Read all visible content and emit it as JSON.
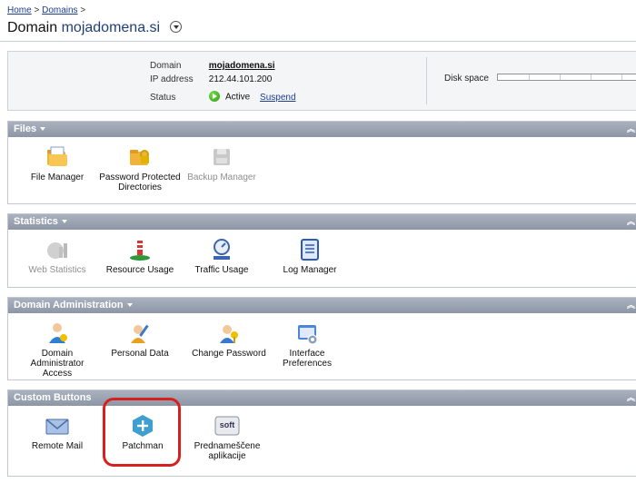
{
  "breadcrumb": {
    "home": "Home",
    "sep": ">",
    "domains": "Domains",
    "sep2": ">"
  },
  "title": {
    "prefix": "Domain",
    "domain": "mojadomena.si"
  },
  "info": {
    "domain_label": "Domain",
    "domain_value": "mojadomena.si",
    "ip_label": "IP address",
    "ip_value": "212.44.101.200",
    "status_label": "Status",
    "status_value": "Active",
    "suspend_link": "Suspend",
    "disk_label": "Disk space"
  },
  "sections": [
    {
      "title": "Files",
      "items": [
        {
          "label": "File Manager",
          "icon": "file-manager-icon"
        },
        {
          "label": "Password Protected Directories",
          "icon": "password-folder-icon"
        },
        {
          "label": "Backup Manager",
          "icon": "backup-manager-icon",
          "disabled": true
        }
      ]
    },
    {
      "title": "Statistics",
      "items": [
        {
          "label": "Web Statistics",
          "icon": "web-statistics-icon",
          "disabled": true
        },
        {
          "label": "Resource Usage",
          "icon": "resource-usage-icon"
        },
        {
          "label": "Traffic Usage",
          "icon": "traffic-usage-icon"
        },
        {
          "label": "Log Manager",
          "icon": "log-manager-icon"
        }
      ]
    },
    {
      "title": "Domain Administration",
      "items": [
        {
          "label": "Domain Administrator Access",
          "icon": "admin-access-icon"
        },
        {
          "label": "Personal Data",
          "icon": "personal-data-icon"
        },
        {
          "label": "Change Password",
          "icon": "change-password-icon"
        },
        {
          "label": "Interface Preferences",
          "icon": "interface-preferences-icon"
        }
      ]
    },
    {
      "title": "Custom Buttons",
      "items": [
        {
          "label": "Remote Mail",
          "icon": "mail-icon"
        },
        {
          "label": "Patchman",
          "icon": "patchman-icon"
        },
        {
          "label": "Prednameščene aplikacije",
          "icon": "soft-icon",
          "icon_text": "soft"
        }
      ]
    }
  ],
  "colors": {
    "header": "#9aa3b2",
    "link": "#1a3d8f",
    "highlight": "#d81f1f"
  }
}
